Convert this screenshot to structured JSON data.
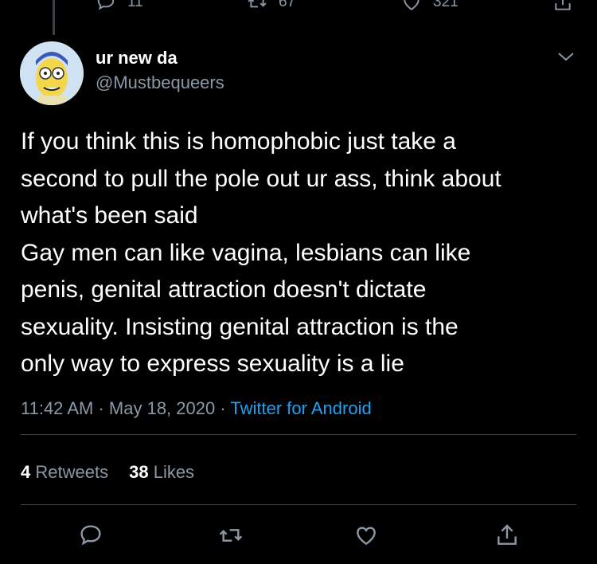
{
  "previous_tweet": {
    "reply_count": "11",
    "retweet_count": "67",
    "like_count": "321"
  },
  "author": {
    "display_name": "ur new da",
    "handle": "@Mustbequeers"
  },
  "tweet": {
    "lines": [
      "If you think this is homophobic just take a",
      "second to pull the pole out ur ass, think about",
      "what's been said",
      "Gay men can like vagina, lesbians can like",
      "penis, genital attraction doesn't dictate",
      "sexuality. Insisting genital attraction is the",
      "only way to express sexuality is a lie"
    ]
  },
  "meta": {
    "time": "11:42 AM",
    "separator": "·",
    "date": "May 18, 2020",
    "source": "Twitter for Android"
  },
  "stats": {
    "retweets_count": "4",
    "retweets_label": "Retweets",
    "likes_count": "38",
    "likes_label": "Likes"
  },
  "icons": {
    "reply": "reply-icon",
    "retweet": "retweet-icon",
    "like": "heart-icon",
    "share": "share-icon",
    "more": "chevron-down-icon"
  },
  "colors": {
    "background": "#000000",
    "text": "#ffffff",
    "muted": "#8b98a5",
    "link": "#1da1f2",
    "divider": "#38444d"
  }
}
